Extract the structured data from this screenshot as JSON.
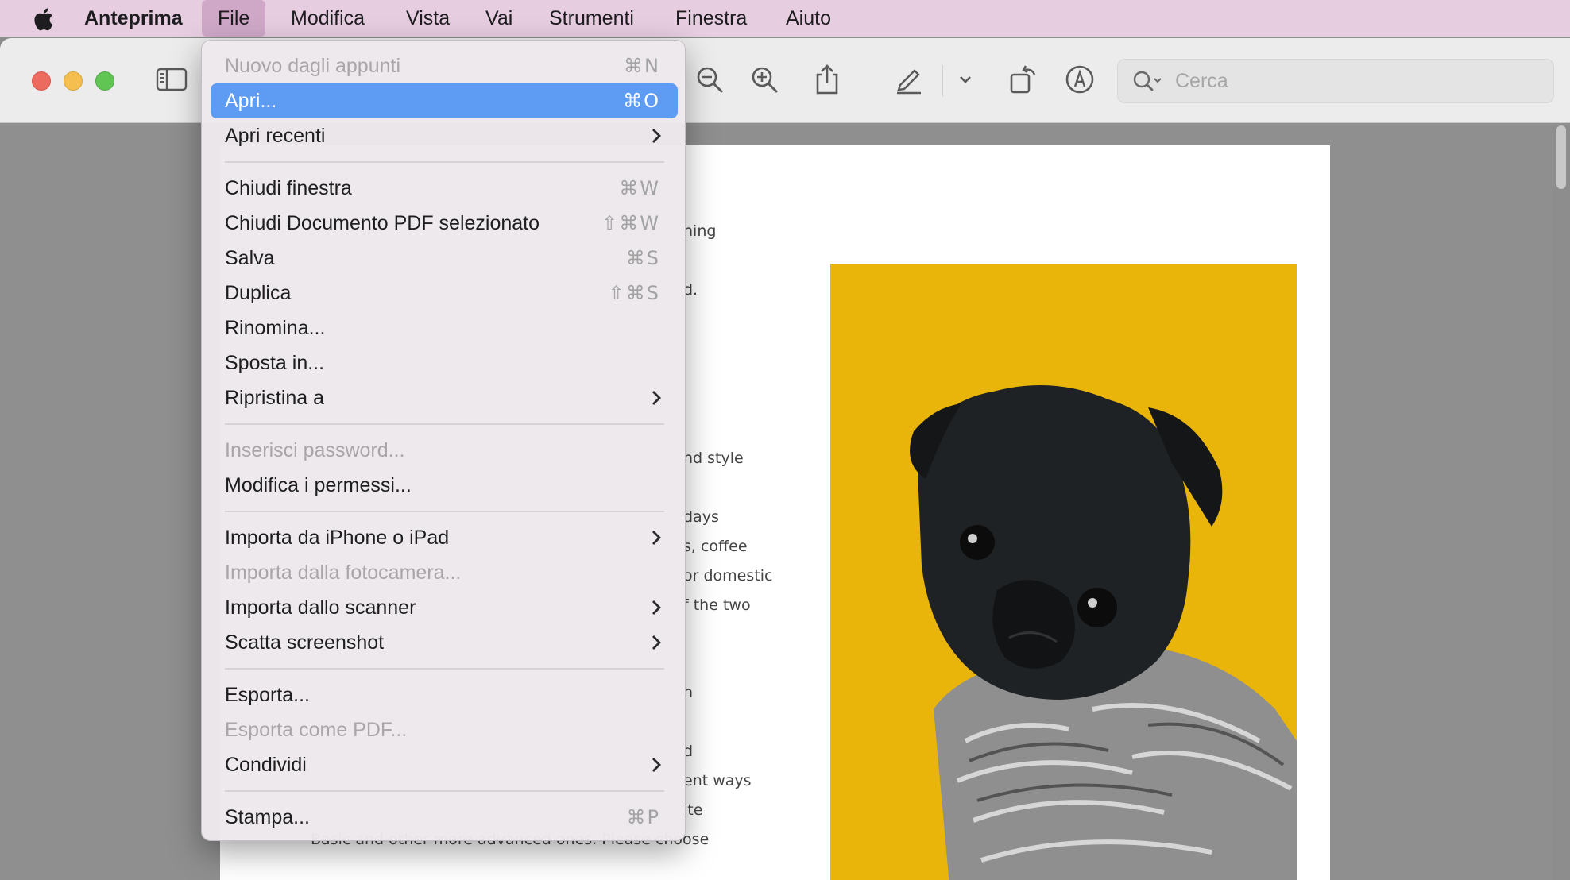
{
  "menubar": {
    "apple_icon": "apple-logo-icon",
    "app_name": "Anteprima",
    "items": [
      "File",
      "Modifica",
      "Vista",
      "Vai",
      "Strumenti",
      "Finestra",
      "Aiuto"
    ]
  },
  "toolbar": {
    "search_placeholder": "Cerca",
    "icons": [
      "sidebar-toggle-icon",
      "zoom-out-icon",
      "zoom-in-icon",
      "share-icon",
      "highlight-pen-icon",
      "chevron-down-icon",
      "rotate-icon",
      "markup-icon",
      "search-icon"
    ]
  },
  "colors": {
    "menubar_bg": "#e6cde0",
    "highlight": "#5e9bf2",
    "close": "#ed6a5e",
    "minimize": "#f5bf4f",
    "zoom": "#61c554",
    "photo_bg": "#e9b50a"
  },
  "file_menu": {
    "items": [
      {
        "label": "Nuovo dagli appunti",
        "shortcut": "⌘N",
        "disabled": true
      },
      {
        "label": "Apri...",
        "shortcut": "⌘O",
        "highlighted": true
      },
      {
        "label": "Apri recenti",
        "submenu": true
      },
      {
        "label": "Chiudi finestra",
        "shortcut": "⌘W"
      },
      {
        "label": "Chiudi Documento PDF selezionato",
        "shortcut": "⇧⌘W"
      },
      {
        "label": "Salva",
        "shortcut": "⌘S"
      },
      {
        "label": "Duplica",
        "shortcut": "⇧⌘S"
      },
      {
        "label": "Rinomina..."
      },
      {
        "label": "Sposta in..."
      },
      {
        "label": "Ripristina a",
        "submenu": true
      },
      {
        "label": "Inserisci password...",
        "disabled": true
      },
      {
        "label": "Modifica i permessi..."
      },
      {
        "label": "Importa da iPhone o iPad",
        "submenu": true
      },
      {
        "label": "Importa dalla fotocamera...",
        "disabled": true
      },
      {
        "label": "Importa dallo scanner",
        "submenu": true
      },
      {
        "label": "Scatta screenshot",
        "submenu": true
      },
      {
        "label": "Esporta..."
      },
      {
        "label": "Esporta come PDF...",
        "disabled": true
      },
      {
        "label": "Condividi",
        "submenu": true
      },
      {
        "label": "Stampa...",
        "shortcut": "⌘P"
      }
    ]
  },
  "document": {
    "text_fragments": [
      "ning",
      "d.",
      "nd style",
      "days",
      "s, coffee",
      "or domestic",
      "f the two",
      "h",
      "d",
      "ent ways",
      "ite",
      "Basic and other more advanced ones. Please choose"
    ],
    "image": "black-pug-in-sweater-photo"
  }
}
